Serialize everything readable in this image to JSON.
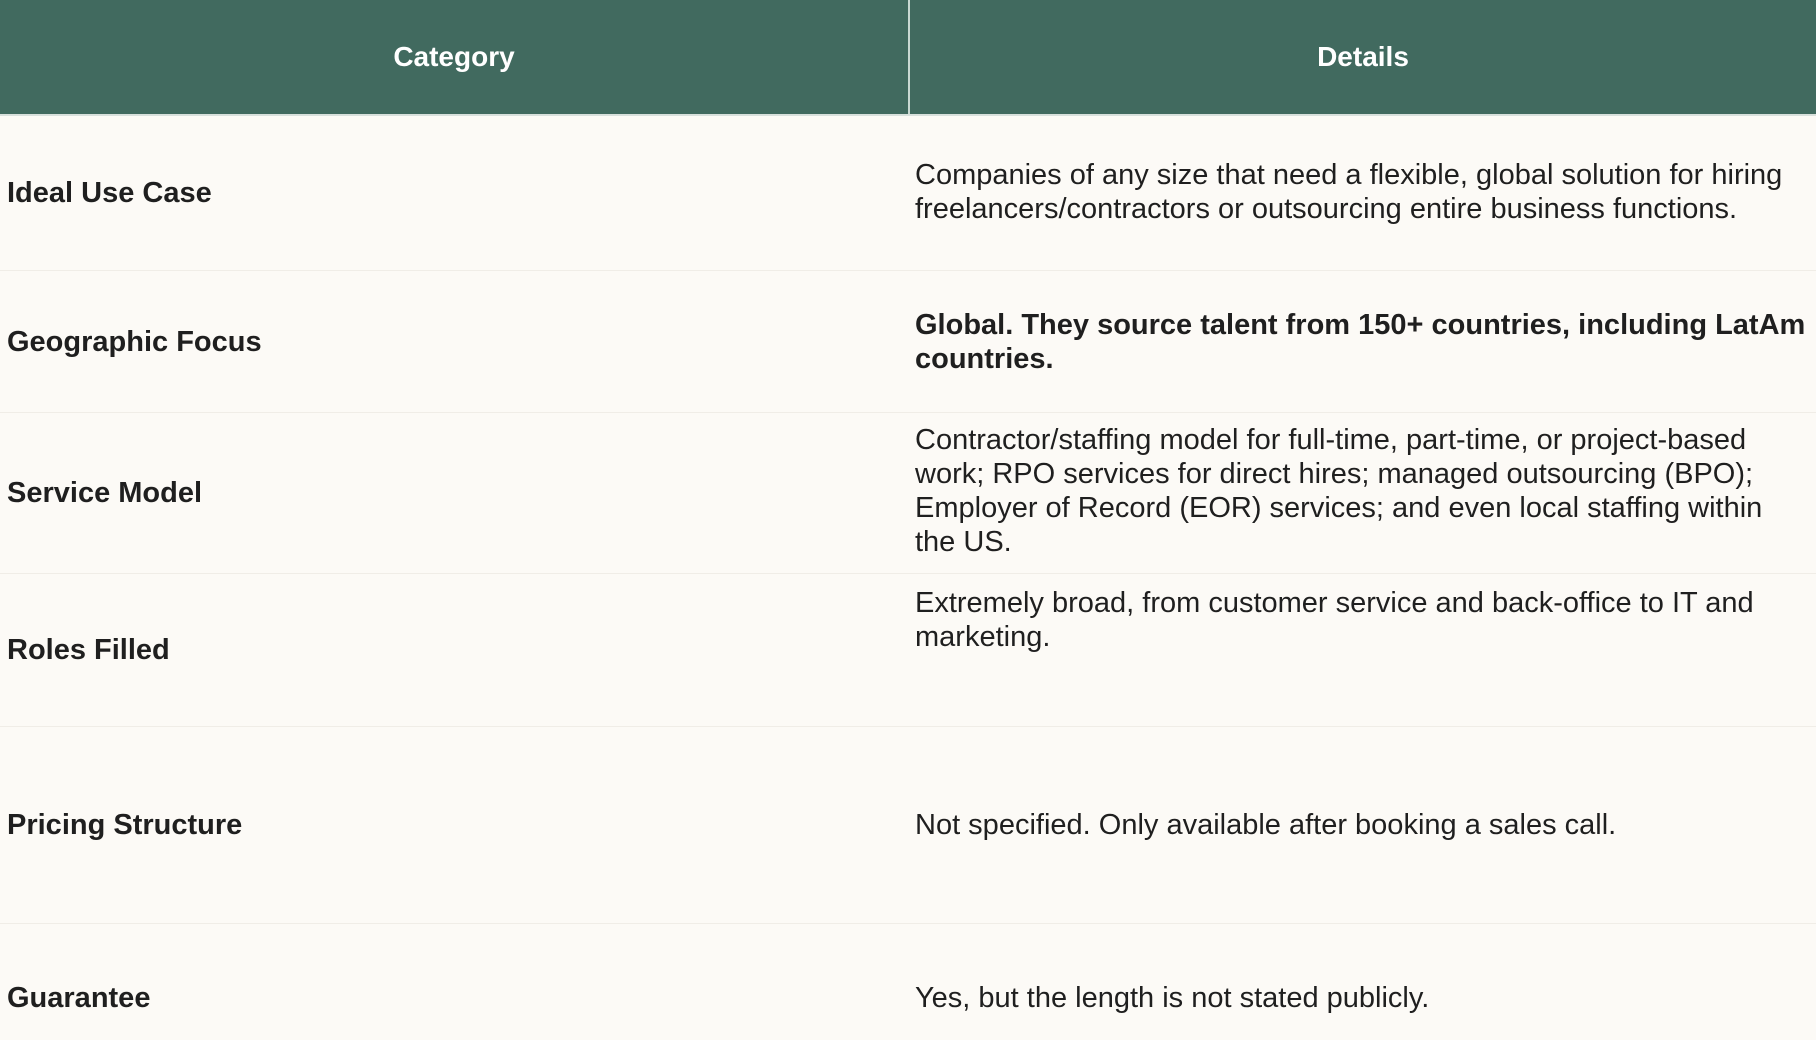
{
  "header": {
    "category": "Category",
    "details": "Details"
  },
  "rows": [
    {
      "category": "Ideal Use Case",
      "details": "Companies of any size that need a flexible, global solution for hiring freelancers/contractors or outsourcing entire business functions."
    },
    {
      "category": "Geographic Focus",
      "details": "Global. They source talent from 150+ countries, including LatAm countries."
    },
    {
      "category": "Service Model",
      "details": "Contractor/staffing model for full-time, part-time, or project-based work; RPO services for direct hires; managed outsourcing (BPO); Employer of Record (EOR) services; and even local staffing within the US."
    },
    {
      "category": "Roles Filled",
      "details": "Extremely broad, from customer service and back-office to IT and marketing."
    },
    {
      "category": "Pricing Structure",
      "details": "Not specified. Only available after booking a sales call."
    },
    {
      "category": "Guarantee",
      "details": "Yes, but the length is not stated publicly."
    }
  ],
  "colors": {
    "header_bg": "#416a5f",
    "header_text": "#ffffff",
    "body_bg": "#fcfaf6",
    "text": "#1f1f1f"
  }
}
